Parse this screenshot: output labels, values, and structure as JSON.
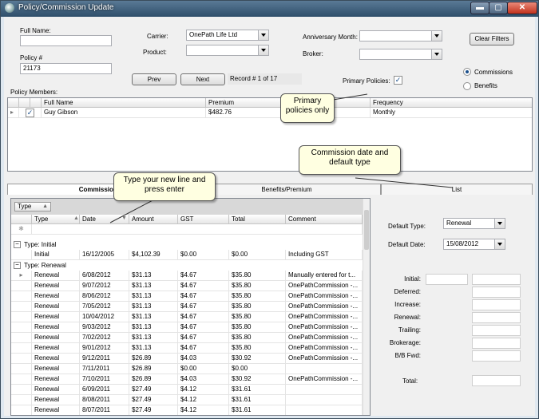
{
  "window": {
    "title": "Policy/Commission Update",
    "minimize": "▬",
    "maximize": "▢",
    "close": "✕"
  },
  "form": {
    "full_name_label": "Full Name:",
    "full_name_value": "",
    "policy_label": "Policy #",
    "policy_value": "21173",
    "carrier_label": "Carrier:",
    "carrier_value": "OnePath Life Ltd",
    "product_label": "Product:",
    "product_value": "",
    "anniversary_label": "Anniversary Month:",
    "anniversary_value": "",
    "broker_label": "Broker:",
    "broker_value": "",
    "clear_filters": "Clear Filters",
    "prev": "Prev",
    "next": "Next",
    "record": "Record # 1 of 17",
    "primary_policies_label": "Primary Policies:",
    "primary_policies_checked": "✓",
    "radio_commissions": "Commissions",
    "radio_benefits": "Benefits"
  },
  "members": {
    "label": "Policy Members:",
    "columns": [
      "Full Name",
      "Premium",
      "Frequency"
    ],
    "row": {
      "name": "Guy Gibson",
      "premium": "$482.76",
      "frequency": "Monthly",
      "checked": "✓"
    }
  },
  "callouts": {
    "primary": "Primary policies only",
    "commission": "Commission date and default type",
    "typeline": "Type your new line and press enter"
  },
  "tabs": {
    "commissions": "Commissions",
    "benefits": "Benefits/Premium",
    "list": "List"
  },
  "commissions": {
    "group_by": "Type",
    "columns": [
      "Type",
      "Date",
      "Amount",
      "GST",
      "Total",
      "Comment"
    ],
    "group_initial": "Type:  Initial",
    "group_renewal": "Type:  Renewal",
    "initial_rows": [
      [
        "Initial",
        "16/12/2005",
        "$4,102.39",
        "$0.00",
        "$0.00",
        "Including GST"
      ]
    ],
    "renewal_rows": [
      [
        "Renewal",
        "6/08/2012",
        "$31.13",
        "$4.67",
        "$35.80",
        "Manually entered for t..."
      ],
      [
        "Renewal",
        "9/07/2012",
        "$31.13",
        "$4.67",
        "$35.80",
        "OnePathCommission -..."
      ],
      [
        "Renewal",
        "8/06/2012",
        "$31.13",
        "$4.67",
        "$35.80",
        "OnePathCommission -..."
      ],
      [
        "Renewal",
        "7/05/2012",
        "$31.13",
        "$4.67",
        "$35.80",
        "OnePathCommission -..."
      ],
      [
        "Renewal",
        "10/04/2012",
        "$31.13",
        "$4.67",
        "$35.80",
        "OnePathCommission -..."
      ],
      [
        "Renewal",
        "9/03/2012",
        "$31.13",
        "$4.67",
        "$35.80",
        "OnePathCommission -..."
      ],
      [
        "Renewal",
        "7/02/2012",
        "$31.13",
        "$4.67",
        "$35.80",
        "OnePathCommission -..."
      ],
      [
        "Renewal",
        "9/01/2012",
        "$31.13",
        "$4.67",
        "$35.80",
        "OnePathCommission -..."
      ],
      [
        "Renewal",
        "9/12/2011",
        "$26.89",
        "$4.03",
        "$30.92",
        "OnePathCommission -..."
      ],
      [
        "Renewal",
        "7/11/2011",
        "$26.89",
        "$0.00",
        "$0.00",
        ""
      ],
      [
        "Renewal",
        "7/10/2011",
        "$26.89",
        "$4.03",
        "$30.92",
        "OnePathCommission -..."
      ],
      [
        "Renewal",
        "6/09/2011",
        "$27.49",
        "$4.12",
        "$31.61",
        ""
      ],
      [
        "Renewal",
        "8/08/2011",
        "$27.49",
        "$4.12",
        "$31.61",
        ""
      ],
      [
        "Renewal",
        "8/07/2011",
        "$27.49",
        "$4.12",
        "$31.61",
        ""
      ]
    ]
  },
  "defaults": {
    "type_label": "Default Type:",
    "type_value": "Renewal",
    "date_label": "Default Date:",
    "date_value": "15/08/2012",
    "fields": [
      "Initial:",
      "Deferred:",
      "Increase:",
      "Renewal:",
      "Trailing:",
      "Brokerage:",
      "B/B Fwd:"
    ],
    "total_label": "Total:"
  }
}
